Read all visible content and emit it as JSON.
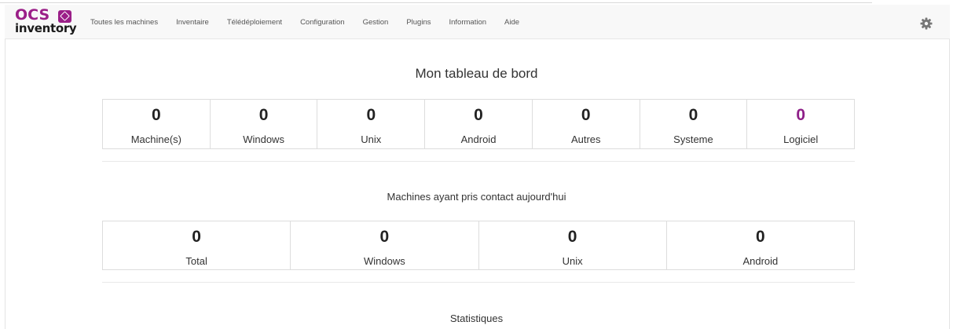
{
  "app": {
    "logo_top": "OCS",
    "logo_bottom": "inventory"
  },
  "nav": {
    "items": [
      {
        "label": "Toutes les machines"
      },
      {
        "label": "Inventaire"
      },
      {
        "label": "Télédéploiement"
      },
      {
        "label": "Configuration"
      },
      {
        "label": "Gestion"
      },
      {
        "label": "Plugins"
      },
      {
        "label": "Information"
      },
      {
        "label": "Aide"
      }
    ],
    "settings_icon": "gear-icon"
  },
  "dashboard": {
    "title": "Mon tableau de bord",
    "counters": [
      {
        "value": "0",
        "label": "Machine(s)"
      },
      {
        "value": "0",
        "label": "Windows"
      },
      {
        "value": "0",
        "label": "Unix"
      },
      {
        "value": "0",
        "label": "Android"
      },
      {
        "value": "0",
        "label": "Autres"
      },
      {
        "value": "0",
        "label": "Systeme"
      },
      {
        "value": "0",
        "label": "Logiciel"
      }
    ]
  },
  "contact_today": {
    "title": "Machines ayant pris contact aujourd'hui",
    "counters": [
      {
        "value": "0",
        "label": "Total"
      },
      {
        "value": "0",
        "label": "Windows"
      },
      {
        "value": "0",
        "label": "Unix"
      },
      {
        "value": "0",
        "label": "Android"
      }
    ]
  },
  "statistics": {
    "title": "Statistiques"
  },
  "colors": {
    "brand": "#9b1f88",
    "accent_value": "#8e1f88",
    "navbar_bg": "#f8f8f8"
  }
}
